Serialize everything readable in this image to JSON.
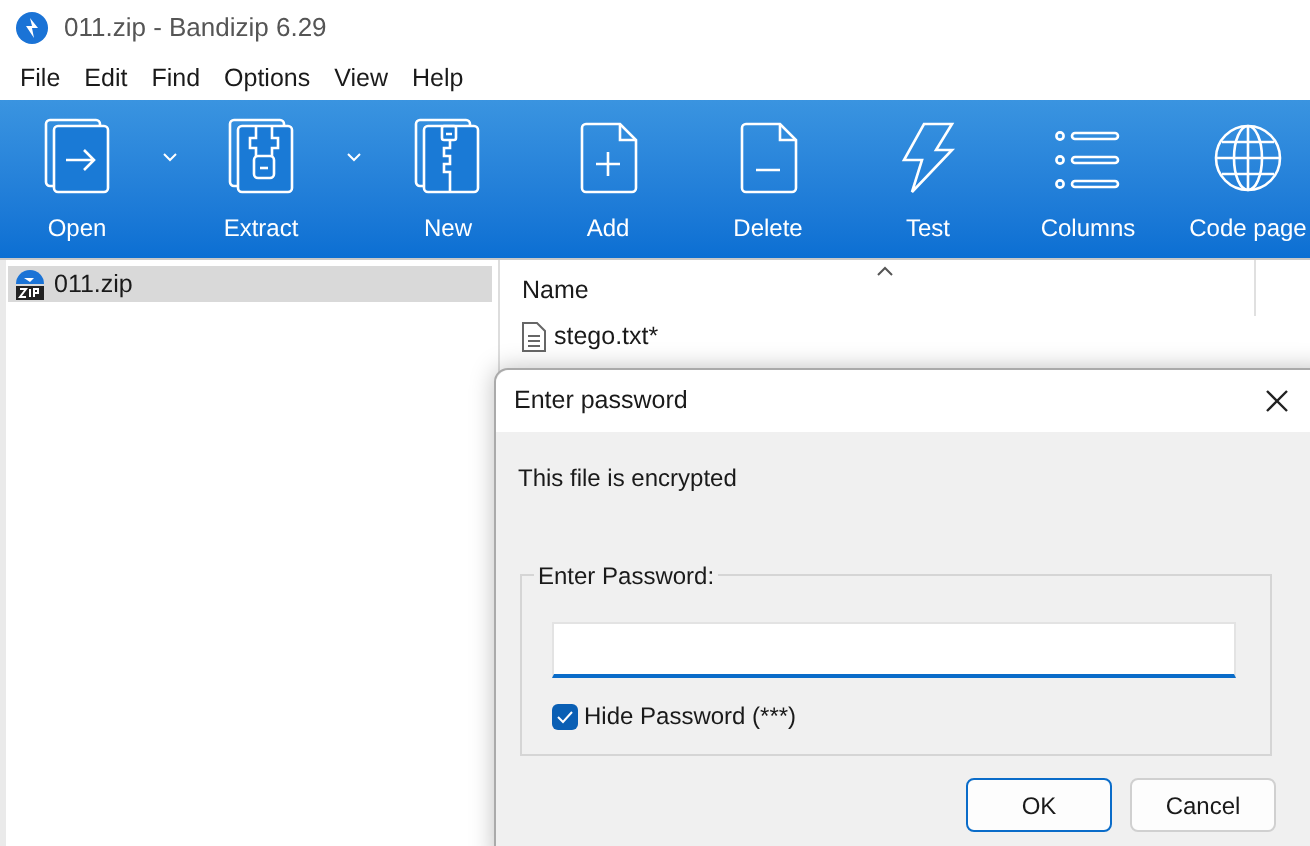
{
  "window": {
    "title": "011.zip - Bandizip 6.29"
  },
  "menu": [
    "File",
    "Edit",
    "Find",
    "Options",
    "View",
    "Help"
  ],
  "toolbar": [
    {
      "label": "Open",
      "has_dropdown": true
    },
    {
      "label": "Extract",
      "has_dropdown": true
    },
    {
      "label": "New",
      "has_dropdown": false
    },
    {
      "label": "Add",
      "has_dropdown": false
    },
    {
      "label": "Delete",
      "has_dropdown": false
    },
    {
      "label": "Test",
      "has_dropdown": false
    },
    {
      "label": "Columns",
      "has_dropdown": false
    },
    {
      "label": "Code page",
      "has_dropdown": false
    }
  ],
  "tree": {
    "items": [
      {
        "label": "011.zip",
        "selected": true
      }
    ]
  },
  "file_list": {
    "columns": [
      {
        "label": "Name",
        "sorted": true
      }
    ],
    "rows": [
      {
        "name": "stego.txt*"
      }
    ]
  },
  "dialog": {
    "title": "Enter password",
    "message": "This file is encrypted",
    "group_label": "Enter Password:",
    "hide_password": {
      "label": "Hide Password (***)",
      "checked": true
    },
    "buttons": [
      {
        "label": "OK",
        "default": true
      },
      {
        "label": "Cancel",
        "default": false
      }
    ]
  }
}
